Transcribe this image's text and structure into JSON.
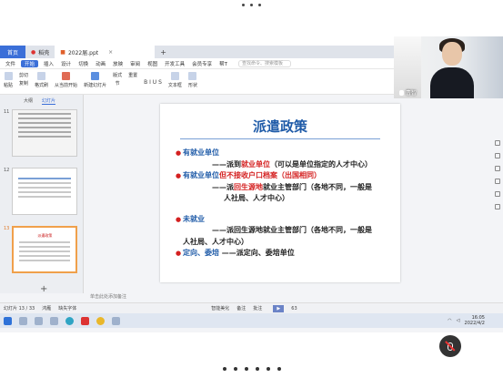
{
  "tabs": {
    "home": "首页",
    "daoke": "稻壳",
    "doc": "2022届.ppt"
  },
  "menu": {
    "file": "文件",
    "items": [
      "开始",
      "插入",
      "设计",
      "切换",
      "动画",
      "放映",
      "审阅",
      "视图",
      "开发工具",
      "会员专享",
      "帮T"
    ],
    "search_placeholder": "查找命令、搜索模板"
  },
  "ribbon": {
    "paste": "粘贴",
    "cut": "剪切",
    "copy": "复制",
    "format_painter": "格式刷",
    "from_current": "从当前开始",
    "new_slide": "新建幻灯片",
    "layout": "版式",
    "section": "节",
    "reset": "重置",
    "format_text": "B  I  U  S",
    "text_box": "文本框",
    "shape": "形状",
    "arrange": "排列"
  },
  "left_panel": {
    "tab_outline": "大纲",
    "tab_slides": "幻灯片",
    "slide_numbers": [
      "11",
      "12",
      "13"
    ],
    "thumb_title": "派遣政策"
  },
  "slide": {
    "title": "派遣政策",
    "lines": [
      {
        "type": "bullet",
        "parts": [
          {
            "t": "有就业单位",
            "c": "blue"
          }
        ]
      },
      {
        "type": "indent",
        "parts": [
          {
            "t": "——派到",
            "c": "blk"
          },
          {
            "t": "就业单位",
            "c": "red"
          },
          {
            "t": "（可以是单位指定的人才中心）",
            "c": "blk"
          }
        ]
      },
      {
        "type": "bullet",
        "parts": [
          {
            "t": "有就业单位",
            "c": "blue"
          },
          {
            "t": "但不接收户口档案（出国相同）",
            "c": "red"
          }
        ]
      },
      {
        "type": "indent",
        "parts": [
          {
            "t": "——派",
            "c": "blk"
          },
          {
            "t": "回生源地",
            "c": "red"
          },
          {
            "t": "就业主管部门（各地不同，一般是",
            "c": "blk"
          }
        ]
      },
      {
        "type": "cont",
        "parts": [
          {
            "t": "人社局、人才中心）",
            "c": "blk"
          }
        ]
      },
      {
        "type": "gap",
        "parts": []
      },
      {
        "type": "bullet",
        "parts": [
          {
            "t": "未就业",
            "c": "blue"
          }
        ]
      },
      {
        "type": "indent",
        "parts": [
          {
            "t": "——派回生源地就业主管部门（各地不同，一般是",
            "c": "blk"
          }
        ]
      },
      {
        "type": "cont0",
        "parts": [
          {
            "t": "人社局、人才中心）",
            "c": "blk"
          }
        ]
      },
      {
        "type": "bullet",
        "parts": [
          {
            "t": "定向、委培",
            "c": "blue"
          },
          {
            "t": "    ——派定向、委培单位",
            "c": "blk"
          }
        ]
      }
    ]
  },
  "notes_placeholder": "单击此处添加备注",
  "status": {
    "slide_counter": "幻灯片 13 / 33",
    "theme": "鸿雁",
    "font_missing": "缺失字体",
    "smart_beautify": "智能美化",
    "notes": "备注",
    "comments": "批注",
    "zoom": "63"
  },
  "taskbar": {
    "time": "16:05",
    "date": "2022/4/2"
  },
  "video": {
    "name": "曹智"
  }
}
